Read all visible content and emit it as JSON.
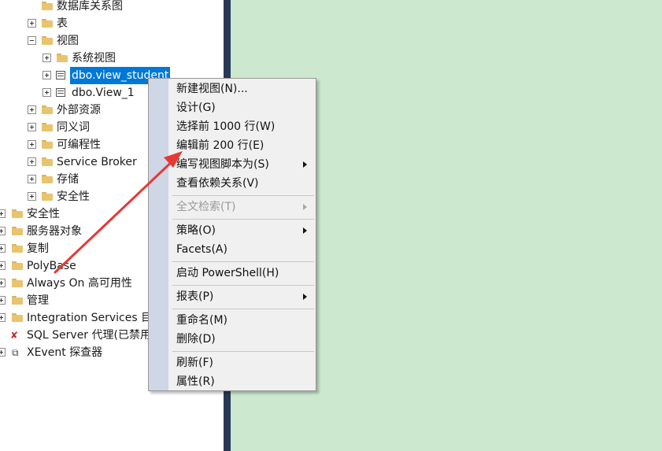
{
  "tree": {
    "items": [
      {
        "label": "数据库关系图",
        "expander": "none"
      },
      {
        "label": "表",
        "expander": "plus"
      },
      {
        "label": "视图",
        "expander": "minus"
      },
      {
        "label": "系统视图",
        "expander": "plus"
      },
      {
        "label": "dbo.view_student",
        "expander": "plus",
        "selected": true
      },
      {
        "label": "dbo.View_1",
        "expander": "plus"
      },
      {
        "label": "外部资源",
        "expander": "plus"
      },
      {
        "label": "同义词",
        "expander": "plus"
      },
      {
        "label": "可编程性",
        "expander": "plus"
      },
      {
        "label": "Service Broker",
        "expander": "plus"
      },
      {
        "label": "存储",
        "expander": "plus"
      },
      {
        "label": "安全性",
        "expander": "plus"
      },
      {
        "label": "安全性",
        "expander": "plus"
      },
      {
        "label": "服务器对象",
        "expander": "plus"
      },
      {
        "label": "复制",
        "expander": "plus"
      },
      {
        "label": "PolyBase",
        "expander": "plus"
      },
      {
        "label": "Always On 高可用性",
        "expander": "plus"
      },
      {
        "label": "管理",
        "expander": "plus"
      },
      {
        "label": "Integration Services 目录",
        "expander": "plus"
      },
      {
        "label": "SQL Server 代理(已禁用代理 XP)",
        "expander": "none"
      },
      {
        "label": "XEvent 探查器",
        "expander": "plus"
      }
    ]
  },
  "context_menu": {
    "items": [
      {
        "label": "新建视图(N)..."
      },
      {
        "label": "设计(G)"
      },
      {
        "label": "选择前 1000 行(W)"
      },
      {
        "label": "编辑前 200 行(E)"
      },
      {
        "label": "编写视图脚本为(S)",
        "submenu": true
      },
      {
        "label": "查看依赖关系(V)"
      },
      {
        "label": "全文检索(T)",
        "submenu": true,
        "disabled": true
      },
      {
        "label": "策略(O)",
        "submenu": true
      },
      {
        "label": "Facets(A)"
      },
      {
        "label": "启动 PowerShell(H)"
      },
      {
        "label": "报表(P)",
        "submenu": true
      },
      {
        "label": "重命名(M)"
      },
      {
        "label": "删除(D)"
      },
      {
        "label": "刷新(F)"
      },
      {
        "label": "属性(R)"
      }
    ]
  },
  "colors": {
    "selection": "#0078d7",
    "document_background": "#cce8cf",
    "splitter": "#293955",
    "annotation_arrow": "#e53935"
  }
}
